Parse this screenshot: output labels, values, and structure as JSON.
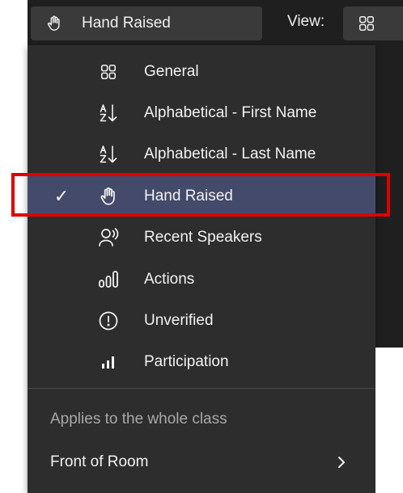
{
  "topbar": {
    "sort_button": {
      "label": "Hand Raised",
      "icon": "hand-raised-icon"
    },
    "view_label": "View:",
    "view_button": {
      "icon": "grid-icon"
    }
  },
  "menu": {
    "items": [
      {
        "label": "General",
        "icon": "grid-icon",
        "selected": false
      },
      {
        "label": "Alphabetical - First Name",
        "icon": "sort-az-icon",
        "selected": false
      },
      {
        "label": "Alphabetical - Last Name",
        "icon": "sort-az-icon",
        "selected": false
      },
      {
        "label": "Hand Raised",
        "icon": "hand-raised-icon",
        "selected": true,
        "check": "✓"
      },
      {
        "label": "Recent Speakers",
        "icon": "speaker-icon",
        "selected": false
      },
      {
        "label": "Actions",
        "icon": "actions-icon",
        "selected": false
      },
      {
        "label": "Unverified",
        "icon": "alert-circle-icon",
        "selected": false
      },
      {
        "label": "Participation",
        "icon": "bar-chart-icon",
        "selected": false
      }
    ],
    "section_caption": "Applies to the whole class",
    "front_of_room": {
      "label": "Front of Room",
      "icon": "chevron-right-icon"
    }
  },
  "colors": {
    "menu_background": "#2d2d2d",
    "selected_background": "#444a6a",
    "highlight_border": "#e00000",
    "text": "#f2f2f2",
    "caption_text": "#a8a8a8"
  }
}
